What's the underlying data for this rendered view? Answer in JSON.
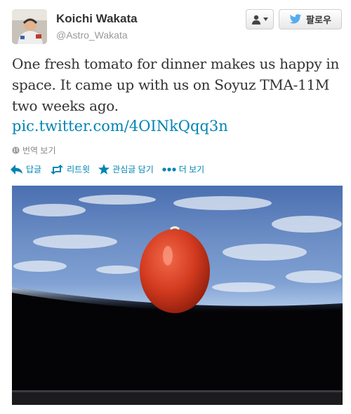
{
  "user": {
    "display_name": "Koichi Wakata",
    "handle": "@Astro_Wakata",
    "avatar_icon": "astronaut-avatar"
  },
  "header_buttons": {
    "user_menu_icon": "user-dropdown-icon",
    "follow_label": "팔로우",
    "follow_icon": "twitter-bird-icon"
  },
  "tweet": {
    "text": "One fresh tomato for dinner makes us happy in space.  It came up with us on Soyuz TMA-11M two weeks ago.",
    "link": "pic.twitter.com/4OINkQqq3n",
    "translate_label": "번역 보기"
  },
  "actions": {
    "reply": "답글",
    "retweet": "리트윗",
    "favorite": "관심글 담기",
    "more": "더 보기"
  },
  "colors": {
    "link": "#0084b4",
    "twitter_blue": "#55acee",
    "tomato": "#d9381e"
  }
}
